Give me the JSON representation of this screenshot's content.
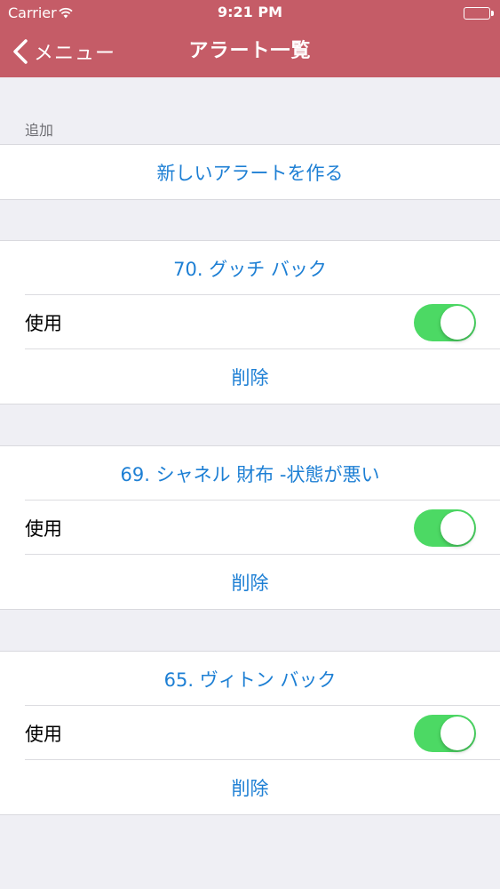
{
  "status_bar": {
    "carrier": "Carrier",
    "time": "9:21 PM"
  },
  "nav": {
    "back_label": "メニュー",
    "title": "アラート一覧"
  },
  "add_section": {
    "header": "追加",
    "create_label": "新しいアラートを作る"
  },
  "alerts": [
    {
      "title": "70. グッチ バック",
      "use_label": "使用",
      "enabled": true,
      "delete_label": "削除"
    },
    {
      "title": "69. シャネル 財布 -状態が悪い",
      "use_label": "使用",
      "enabled": true,
      "delete_label": "削除"
    },
    {
      "title": "65. ヴィトン バック",
      "use_label": "使用",
      "enabled": true,
      "delete_label": "削除"
    }
  ],
  "colors": {
    "nav_background": "#c55c67",
    "link": "#1d7fd4",
    "toggle_on": "#4cd964",
    "page_background": "#efeff4"
  }
}
